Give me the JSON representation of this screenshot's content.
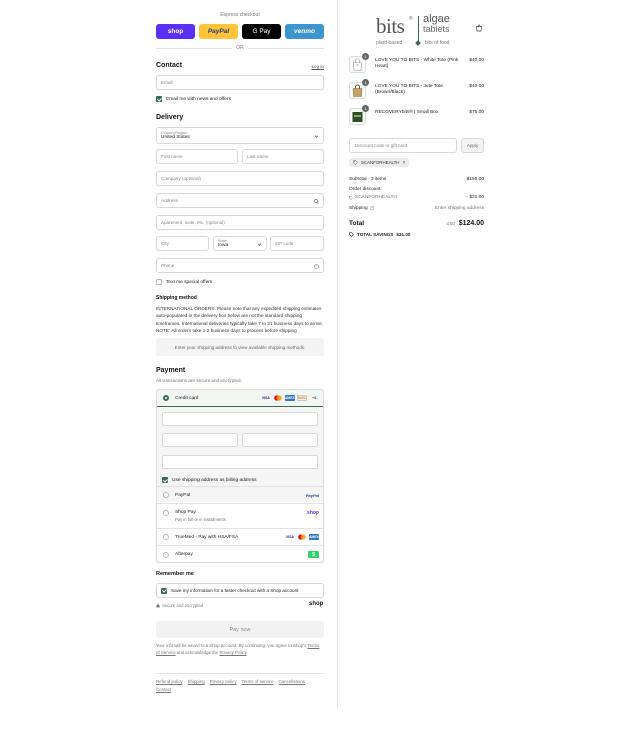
{
  "express": {
    "label": "Express checkout",
    "shop": "shop",
    "paypal": "PayPal",
    "gpay": "G Pay",
    "venmo": "venmo",
    "or": "OR"
  },
  "contact": {
    "title": "Contact",
    "login": "Log in",
    "email_placeholder": "Email",
    "news_label": "Email me with news and offers"
  },
  "delivery": {
    "title": "Delivery",
    "country_label": "Country/Region",
    "country_value": "United States",
    "first_name": "First name",
    "last_name": "Last name",
    "company": "Company (optional)",
    "address": "Address",
    "apartment": "Apartment, suite, etc. (optional)",
    "city": "City",
    "state_label": "State",
    "state_value": "Iowa",
    "zip": "ZIP code",
    "phone": "Phone",
    "text_offers": "Text me special offers"
  },
  "shipping": {
    "title": "Shipping method",
    "notice": "INTERNATIONAL ORDERS: Please note that any expedited shipping estimates auto-populated in the delivery box below are not the standard shipping timeframes. International deliveries typically take 7 to 21 business days to arrive. NOTE: All orders take 1-2 business days to process before shipping",
    "placeholder": "Enter your shipping address to view available shipping methods."
  },
  "payment": {
    "title": "Payment",
    "subtitle": "All transactions are secure and encrypted.",
    "credit_card": "Credit card",
    "card_brands": [
      "VISA",
      "MC",
      "AMEX",
      "DISC"
    ],
    "more_brands": "+3",
    "billing_same": "Use shipping address as billing address",
    "paypal": "PayPal",
    "shoppay": "Shop Pay",
    "shoppay_sub": "Pay in full or in installments",
    "shop_logo": "shop",
    "truemed": "TrueMed - Pay with HSA/FSA",
    "afterpay": "Afterpay",
    "afterpay_logo": "$"
  },
  "remember": {
    "title": "Remember me",
    "save_label": "Save my information for a faster checkout with a Shop account",
    "secure": "Secure and encrypted",
    "shop_logo": "shop"
  },
  "pay_now": "Pay now",
  "fine_print": {
    "text1": "Your info will be saved to a Shop account. By continuing, you agree to Shop's ",
    "terms": "Terms of Service",
    "text2": " and acknowledge the ",
    "privacy": "Privacy Policy",
    "text3": "."
  },
  "footer": [
    "Refund policy",
    "Shipping",
    "Privacy policy",
    "Terms of service",
    "Cancellations",
    "Contact"
  ],
  "logo": {
    "brand": "bits",
    "plant": "plant-based",
    "algae": "algae",
    "tablets": "tablets",
    "bits_food": "bits of food"
  },
  "cart": {
    "items": [
      {
        "qty": "1",
        "name": "LOVE YOU TO BITS - White Tote (Pink Heart)",
        "price": "$40.00"
      },
      {
        "qty": "1",
        "name": "LOVE YOU TO BITS - Jute Tote (Brown/Black)",
        "price": "$40.00"
      },
      {
        "qty": "1",
        "name": "RECOVERYbits® | Small Box",
        "price": "$75.00"
      }
    ],
    "discount_placeholder": "Discount code or gift card",
    "apply": "Apply",
    "code": "SCANFORHEALTH",
    "subtotal_label": "Subtotal · 3 items",
    "subtotal": "$155.00",
    "order_discount": "Order discount",
    "discount_code": "SCANFORHEALTH",
    "discount_amount": "- $31.00",
    "shipping_label": "Shipping",
    "shipping_value": "Enter shipping address",
    "total_label": "Total",
    "currency": "USD",
    "total": "$124.00",
    "savings_label": "TOTAL SAVINGS",
    "savings": "$31.00"
  },
  "colors": {
    "shop": "#5a31f4",
    "paypal": "#ffc439",
    "gpay": "#000000",
    "venmo": "#3d95ce",
    "accent": "#3a6b52"
  }
}
